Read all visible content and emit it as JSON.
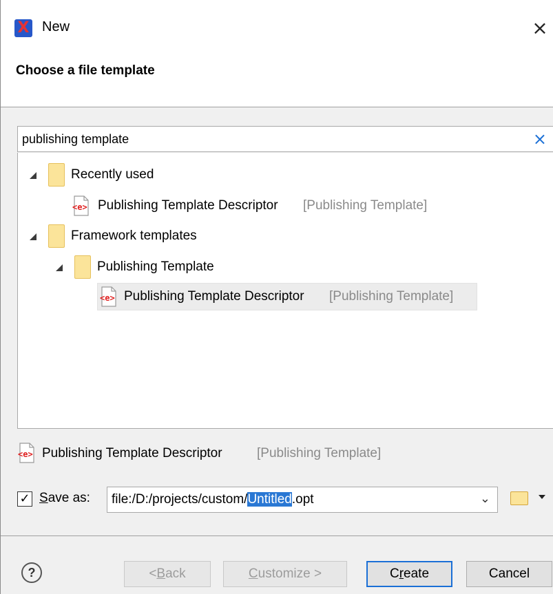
{
  "window": {
    "title": "New",
    "close_glyph": "×",
    "app_icon_letter": "X"
  },
  "header": {
    "title": "Choose a file template"
  },
  "search": {
    "value": "publishing template",
    "clear_glyph": "×"
  },
  "tree": {
    "groups": [
      {
        "label": "Recently used",
        "items": [
          {
            "name": "Publishing Template Descriptor",
            "category": "[Publishing Template]"
          }
        ]
      },
      {
        "label": "Framework templates",
        "subgroups": [
          {
            "label": "Publishing Template",
            "items": [
              {
                "name": "Publishing Template Descriptor",
                "category": "[Publishing Template]",
                "selected": true
              }
            ]
          }
        ]
      }
    ]
  },
  "description": {
    "name": "Publishing Template Descriptor",
    "category": "[Publishing Template]"
  },
  "save_as": {
    "checked": true,
    "check_glyph": "✓",
    "label_accel": "S",
    "label_rest": "ave as:",
    "path_prefix": "file:/D:/projects/custom/",
    "path_selected": "Untitled",
    "path_suffix": ".opt",
    "dropdown_glyph": "⌄"
  },
  "buttons": {
    "help_glyph": "?",
    "back_prefix": "< ",
    "back_accel": "B",
    "back_rest": "ack",
    "customize_accel": "C",
    "customize_rest": "ustomize >",
    "create_prefix": "C",
    "create_accel": "r",
    "create_rest": "eate",
    "cancel": "Cancel"
  },
  "colors": {
    "accent": "#1a6fd6",
    "folder": "#fbe49a",
    "template_icon": "#e02020",
    "selection_highlight": "#2a78d4",
    "muted_text": "#8a8a8a"
  }
}
